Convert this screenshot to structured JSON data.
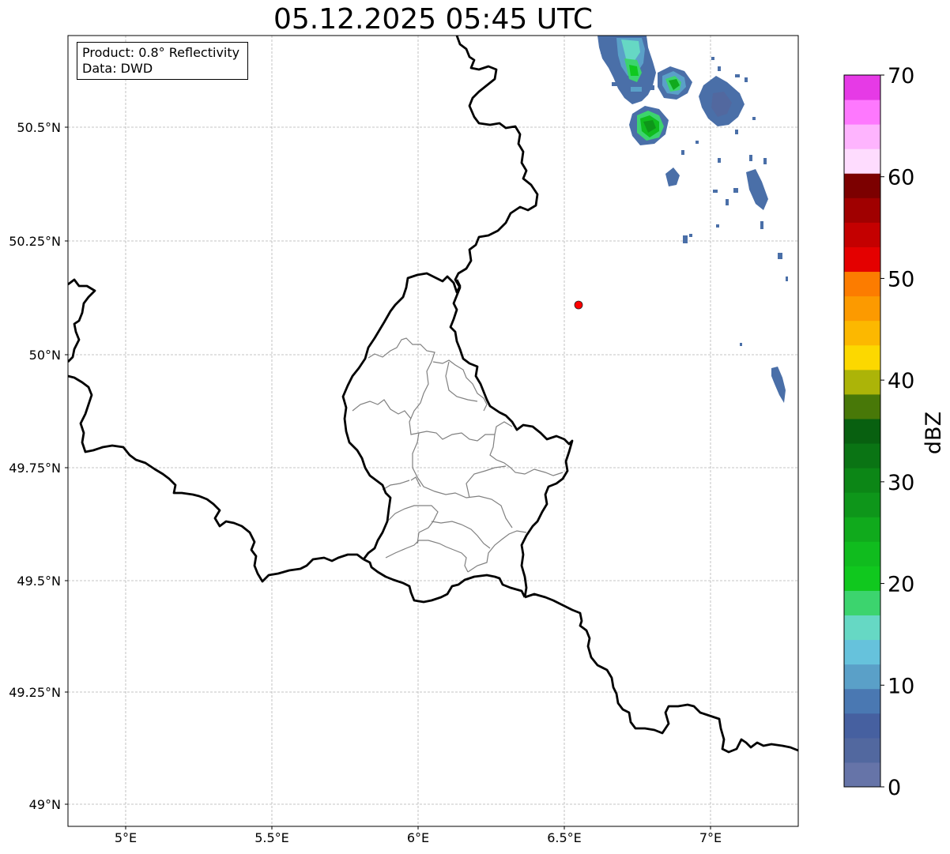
{
  "title": "05.12.2025 05:45 UTC",
  "info": {
    "product": "Product: 0.8° Reflectivity",
    "data_source": "Data: DWD"
  },
  "axes": {
    "x_ticks": [
      "5°E",
      "5.5°E",
      "6°E",
      "6.5°E",
      "7°E"
    ],
    "y_ticks": [
      "50.5°N",
      "50.25°N",
      "50°N",
      "49.75°N",
      "49.5°N",
      "49.25°N",
      "49°N"
    ]
  },
  "colorbar": {
    "label": "dBZ",
    "ticks": [
      "0",
      "10",
      "20",
      "30",
      "40",
      "50",
      "60",
      "70"
    ],
    "colors": [
      "#6674a8",
      "#52689f",
      "#4660a0",
      "#4a78b2",
      "#5aa0c8",
      "#66c2dc",
      "#66d8c4",
      "#3cd46e",
      "#10c81e",
      "#10bc1e",
      "#10aa1c",
      "#0e961a",
      "#0c8616",
      "#0a7414",
      "#086010",
      "#487808",
      "#acb408",
      "#fcd800",
      "#fcb800",
      "#fc9a00",
      "#fc7c00",
      "#e40000",
      "#c40000",
      "#a00000",
      "#7c0000",
      "#fedcfe",
      "#feb4fe",
      "#fe78fe",
      "#e63ae6"
    ]
  },
  "marker": {
    "name": "radar-site",
    "lon": 6.55,
    "lat": 50.11,
    "color": "#ff0000"
  },
  "colors": {
    "border": "#000000",
    "admin": "#808080",
    "grid": "#b4b4b4"
  }
}
